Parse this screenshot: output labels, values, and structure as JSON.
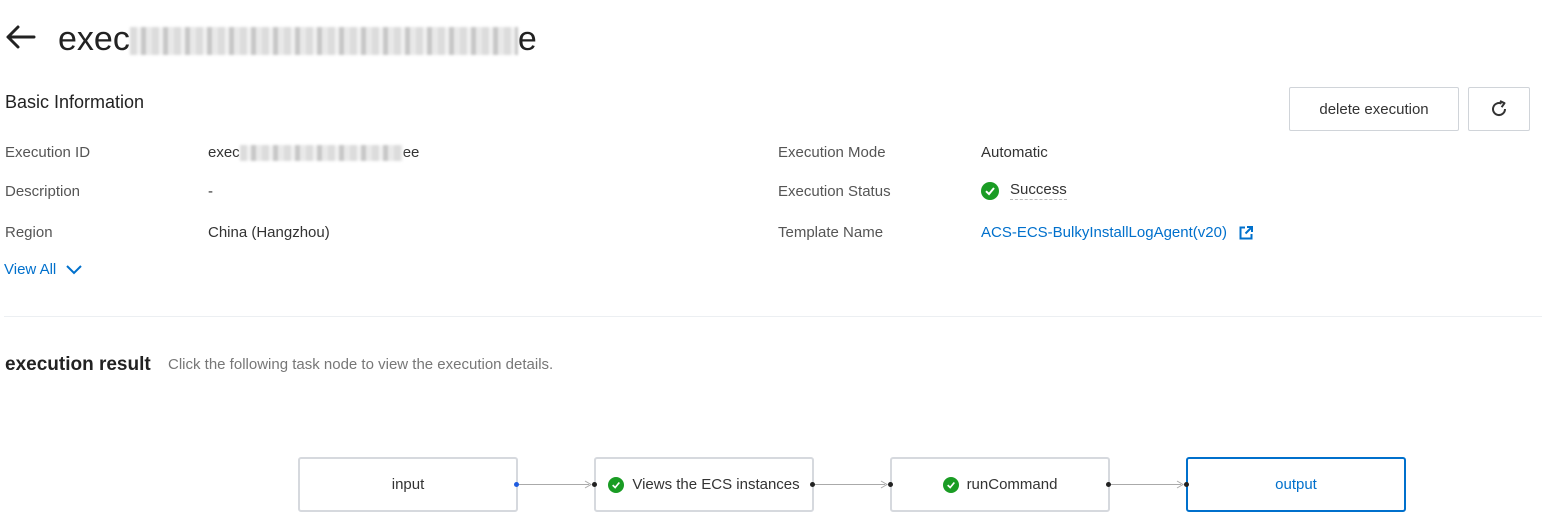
{
  "header": {
    "back_icon": "arrow-left-icon",
    "title_prefix": "exec",
    "title_suffix": "e"
  },
  "basic_info": {
    "title": "Basic Information",
    "delete_label": "delete execution",
    "refresh_icon": "refresh-icon",
    "rows": {
      "execution_id": {
        "label": "Execution ID",
        "value_prefix": "exec",
        "value_suffix": "ee"
      },
      "description": {
        "label": "Description",
        "value": "-"
      },
      "region": {
        "label": "Region",
        "value": "China (Hangzhou)"
      },
      "execution_mode": {
        "label": "Execution Mode",
        "value": "Automatic"
      },
      "execution_status": {
        "label": "Execution Status",
        "value": "Success"
      },
      "template_name": {
        "label": "Template Name",
        "value": "ACS-ECS-BulkyInstallLogAgent(v20)"
      }
    },
    "view_all_label": "View All"
  },
  "execution_result": {
    "title": "execution result",
    "hint": "Click the following task node to view the execution details.",
    "nodes": [
      {
        "label": "input",
        "status": ""
      },
      {
        "label": "Views the ECS instances",
        "status": "success"
      },
      {
        "label": "runCommand",
        "status": "success"
      },
      {
        "label": "output",
        "status": ""
      }
    ]
  },
  "colors": {
    "link": "#0070cc",
    "success": "#1a9c24",
    "border": "#d6d9de"
  }
}
